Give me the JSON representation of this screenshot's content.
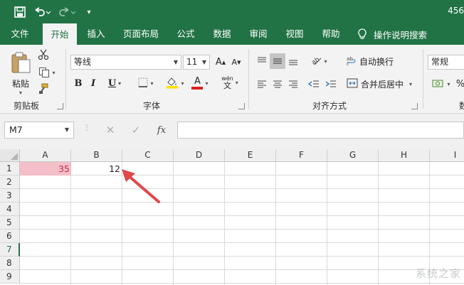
{
  "title_bar": {
    "title_fragment": "456",
    "qat_more": "▾"
  },
  "tabs": [
    "文件",
    "开始",
    "插入",
    "页面布局",
    "公式",
    "数据",
    "审阅",
    "视图",
    "帮助"
  ],
  "active_tab": "开始",
  "tell_me": "操作说明搜索",
  "ribbon": {
    "clipboard": {
      "paste_label": "粘贴",
      "group_label": "剪贴板"
    },
    "font": {
      "font_name": "等线",
      "font_size": "11",
      "grow_label": "A",
      "shrink_label": "A",
      "bold_label": "B",
      "italic_label": "I",
      "underline_label": "U",
      "font_color_label": "A",
      "phonetic_label": "wén",
      "group_label": "字体"
    },
    "alignment": {
      "wrap_text": "自动换行",
      "merge_center": "合并后居中",
      "group_label": "对齐方式"
    },
    "number": {
      "format": "常规",
      "group_label_partial": "数"
    }
  },
  "formula_bar": {
    "name_box": "M7",
    "dots": "⋮",
    "cancel_icon": "✕",
    "enter_icon": "✓",
    "fx_label": "fx",
    "formula": ""
  },
  "grid": {
    "columns": [
      "A",
      "B",
      "C",
      "D",
      "E",
      "F",
      "G",
      "H",
      "I"
    ],
    "rows": [
      "1",
      "2",
      "3",
      "4",
      "5",
      "6",
      "7",
      "8",
      "9"
    ],
    "selected_row": "7",
    "cells": {
      "A1": "35",
      "B1": "12"
    },
    "highlight_color": "#f4bfc8",
    "highlight_text_color": "#c0314a"
  },
  "annotation": {
    "arrow_color": "#e0484a"
  },
  "watermark": "系统之家",
  "colors": {
    "brand": "#217346",
    "ribbon_bg": "#f3f3f3"
  }
}
